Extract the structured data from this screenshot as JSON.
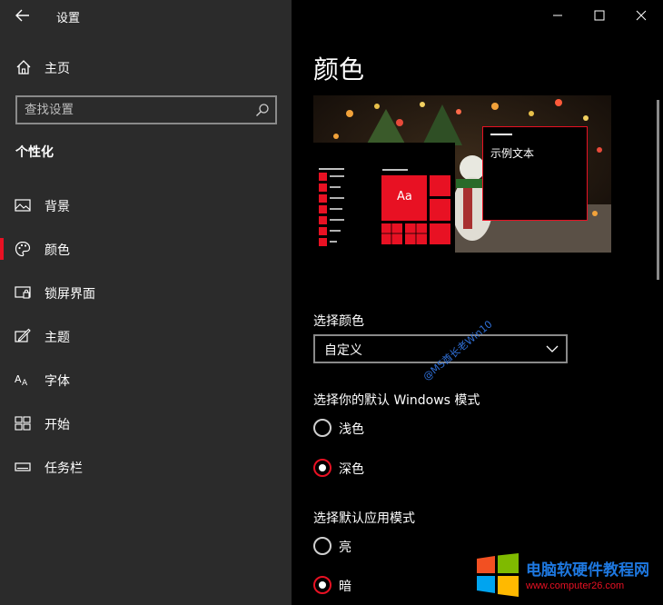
{
  "window": {
    "title": "设置"
  },
  "sidebar": {
    "home_label": "主页",
    "search_placeholder": "查找设置",
    "section_title": "个性化",
    "items": [
      {
        "label": "背景",
        "icon": "picture-icon"
      },
      {
        "label": "颜色",
        "icon": "palette-icon",
        "selected": true
      },
      {
        "label": "锁屏界面",
        "icon": "lock-screen-icon"
      },
      {
        "label": "主题",
        "icon": "theme-icon"
      },
      {
        "label": "字体",
        "icon": "font-icon"
      },
      {
        "label": "开始",
        "icon": "start-icon"
      },
      {
        "label": "任务栏",
        "icon": "taskbar-icon"
      }
    ]
  },
  "main": {
    "page_title": "颜色",
    "preview": {
      "tile_text": "Aa",
      "sample_text": "示例文本"
    },
    "choose_color": {
      "label": "选择颜色",
      "value": "自定义"
    },
    "windows_mode": {
      "label": "选择你的默认 Windows 模式",
      "options": [
        {
          "label": "浅色",
          "checked": false
        },
        {
          "label": "深色",
          "checked": true
        }
      ]
    },
    "app_mode": {
      "label": "选择默认应用模式",
      "options": [
        {
          "label": "亮",
          "checked": false
        },
        {
          "label": "暗",
          "checked": true
        }
      ]
    }
  },
  "overlay": {
    "watermark": "@MS酋长老Win10",
    "brand_name": "电脑软硬件教程网",
    "brand_url": "www.computer26.com"
  },
  "colors": {
    "accent": "#e81123",
    "sidebar_bg": "#2b2b2b",
    "main_bg": "#000000"
  }
}
